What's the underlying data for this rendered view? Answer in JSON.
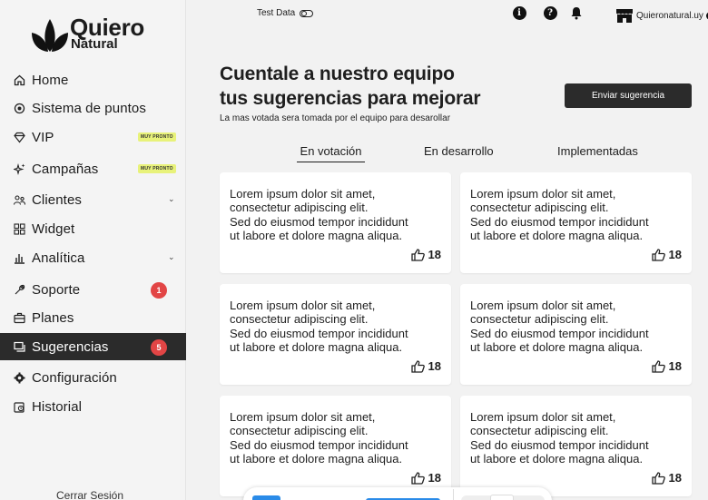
{
  "brand": {
    "name_line1": "Quiero",
    "name_line2": "Natural"
  },
  "sidebar": {
    "items": [
      {
        "label": "Home",
        "icon": "home-icon"
      },
      {
        "label": "Sistema de puntos",
        "icon": "points-icon"
      },
      {
        "label": "VIP",
        "icon": "diamond-icon",
        "tag": "MUY PRONTO"
      },
      {
        "label": "Campañas",
        "icon": "sparkles-icon",
        "tag": "MUY PRONTO"
      },
      {
        "label": "Clientes",
        "icon": "users-icon"
      },
      {
        "label": "Widget",
        "icon": "grid-icon"
      },
      {
        "label": "Analítica",
        "icon": "bar-chart-icon"
      },
      {
        "label": "Soporte",
        "icon": "wrench-icon",
        "badge": "1"
      },
      {
        "label": "Planes",
        "icon": "briefcase-icon"
      },
      {
        "label": "Sugerencias",
        "icon": "chat-icon",
        "badge": "5",
        "active": true
      },
      {
        "label": "Configuración",
        "icon": "gear-icon"
      },
      {
        "label": "Historial",
        "icon": "history-icon"
      }
    ],
    "logout": "Cerrar Sesión"
  },
  "topbar": {
    "test_data_label": "Test Data",
    "store_name": "Quieronatural.uy"
  },
  "header": {
    "title_line1": "Cuentale a nuestro equipo",
    "title_line2": "tus sugerencias para mejorar",
    "subtitle": "La mas votada sera tomada por el equipo para desarollar",
    "cta": "Enviar sugerencia"
  },
  "tabs": [
    {
      "label": "En votación",
      "active": true
    },
    {
      "label": "En desarrollo"
    },
    {
      "label": "Implementadas"
    }
  ],
  "cards": [
    {
      "line1": "Lorem ipsum dolor sit amet,",
      "line2": "consectetur adipiscing elit.",
      "line3": "Sed do eiusmod tempor incididunt",
      "line4": "ut labore et dolore magna aliqua.",
      "votes": "18"
    },
    {
      "line1": "Lorem ipsum dolor sit amet,",
      "line2": "consectetur adipiscing elit.",
      "line3": "Sed do eiusmod tempor incididunt",
      "line4": "ut labore et dolore magna aliqua.",
      "votes": "18"
    },
    {
      "line1": "Lorem ipsum dolor sit amet,",
      "line2": "consectetur adipiscing elit.",
      "line3": "Sed do eiusmod tempor incididunt",
      "line4": "ut labore et dolore magna aliqua.",
      "votes": "18"
    },
    {
      "line1": "Lorem ipsum dolor sit amet,",
      "line2": "consectetur adipiscing elit.",
      "line3": "Sed do eiusmod tempor incididunt",
      "line4": "ut labore et dolore magna aliqua.",
      "votes": "18"
    },
    {
      "line1": "Lorem ipsum dolor sit amet,",
      "line2": "consectetur adipiscing elit.",
      "line3": "Sed do eiusmod tempor incididunt",
      "line4": "ut labore et dolore magna aliqua.",
      "votes": "18"
    },
    {
      "line1": "Lorem ipsum dolor sit amet,",
      "line2": "consectetur adipiscing elit.",
      "line3": "Sed do eiusmod tempor incididunt",
      "line4": "ut labore et dolore magna aliqua.",
      "votes": "18"
    }
  ],
  "colors": {
    "accent_dark": "#2b2b2b",
    "badge": "#e24545",
    "soon_tag": "#e8f27a",
    "link_blue": "#2a8be8"
  }
}
